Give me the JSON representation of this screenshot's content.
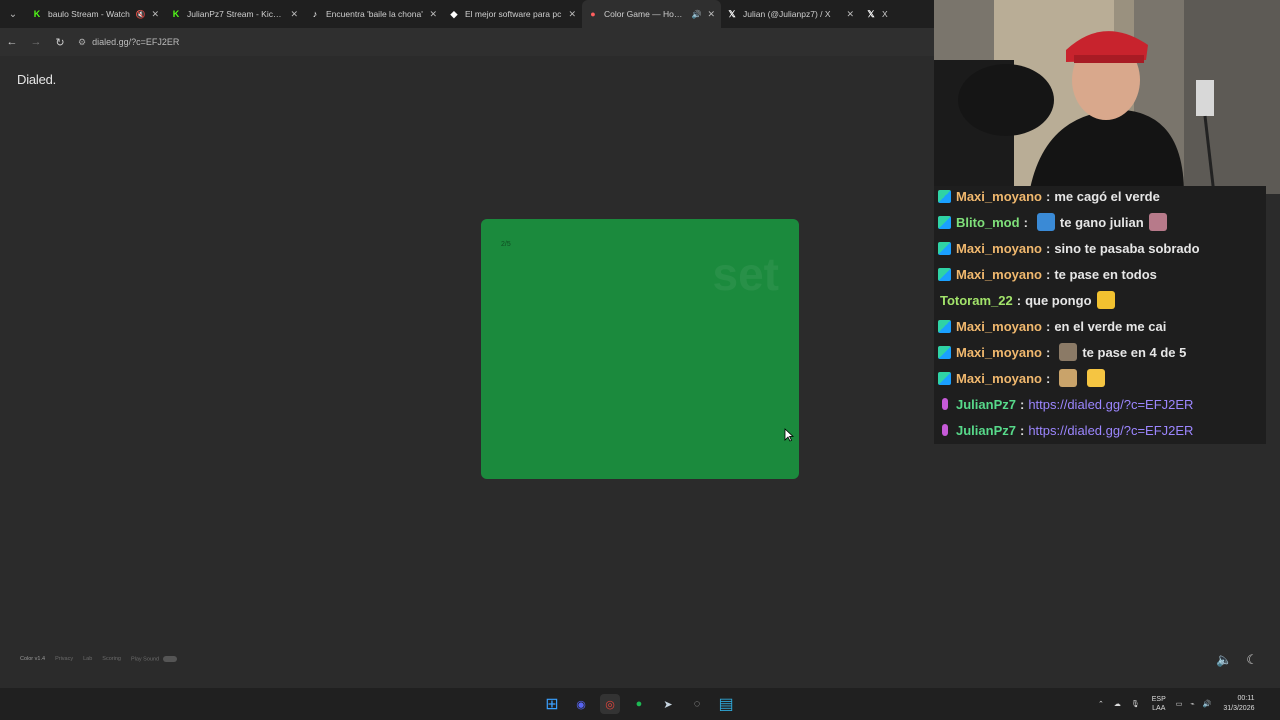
{
  "browser": {
    "tabs": [
      {
        "title": "baulo Stream - Watch",
        "icon": "kick-icon",
        "color": "#53fc18",
        "extra": "🔇",
        "active": false
      },
      {
        "title": "JulianPz7 Stream - Kick D",
        "icon": "kick-icon",
        "color": "#53fc18",
        "extra": "",
        "active": false
      },
      {
        "title": "Encuentra 'baile la chona'",
        "icon": "tiktok-icon",
        "color": "#ffffff",
        "extra": "",
        "active": false
      },
      {
        "title": "El mejor software para pc",
        "icon": "app-icon",
        "color": "#ffffff",
        "extra": "",
        "active": false
      },
      {
        "title": "Color Game — How W",
        "icon": "color-wheel-icon",
        "color": "#ff5e5e",
        "extra": "🔊",
        "active": true
      },
      {
        "title": "Julian (@Julianpz7) / X",
        "icon": "x-icon",
        "color": "#ffffff",
        "extra": "",
        "active": false
      },
      {
        "title": "X",
        "icon": "x-icon",
        "color": "#ffffff",
        "extra": "",
        "active": false
      }
    ],
    "url": "dialed.gg/?c=EFJ2ER"
  },
  "page": {
    "logo": "Dialed.",
    "card": {
      "counter": "2/5",
      "watermark": "set",
      "color": "#1b8a3d"
    },
    "footer": {
      "version": "Color v1.4",
      "links": [
        "Privacy",
        "Lab",
        "Scoring",
        "Play Sound"
      ]
    },
    "icons": [
      "volume-icon",
      "moon-icon"
    ]
  },
  "chat": {
    "messages": [
      {
        "badge": "mod",
        "user": "Maxi_moyano",
        "color": "#f0b86e",
        "text": "me cagó el verde"
      },
      {
        "badge": "mod",
        "user": "Blito_mod",
        "color": "#7fe07a",
        "text": "te gano julian",
        "emote_before": "#3a8ad6",
        "emote_after": "#b77a8a"
      },
      {
        "badge": "mod",
        "user": "Maxi_moyano",
        "color": "#f0b86e",
        "text": "sino te pasaba sobrado"
      },
      {
        "badge": "mod",
        "user": "Maxi_moyano",
        "color": "#f0b86e",
        "text": "te pase en todos"
      },
      {
        "badge": "none",
        "user": "Totoram_22",
        "color": "#a2e36a",
        "text": "que pongo",
        "emote_after": "#f2c230"
      },
      {
        "badge": "mod",
        "user": "Maxi_moyano",
        "color": "#f0b86e",
        "text": "en el verde me cai"
      },
      {
        "badge": "mod",
        "user": "Maxi_moyano",
        "color": "#f0b86e",
        "text": "te pase en 4 de 5",
        "emote_before": "#8b7a66"
      },
      {
        "badge": "mod",
        "user": "Maxi_moyano",
        "color": "#f0b86e",
        "text": "",
        "emote_before": "#c9a36a",
        "emote_after": "#f5c542"
      },
      {
        "badge": "mic",
        "user": "JulianPz7",
        "color": "#57d98a",
        "link": "https://dialed.gg/?c=EFJ2ER"
      },
      {
        "badge": "mic",
        "user": "JulianPz7",
        "color": "#57d98a",
        "link": "https://dialed.gg/?c=EFJ2ER"
      }
    ]
  },
  "taskbar": {
    "apps": [
      {
        "name": "windows-start-icon",
        "color": "#3aa0ff"
      },
      {
        "name": "discord-icon",
        "color": "#5865f2"
      },
      {
        "name": "chrome-icon",
        "color": "#e8453c"
      },
      {
        "name": "spotify-icon",
        "color": "#1db954"
      },
      {
        "name": "steam-icon",
        "color": "#c7d5e0"
      },
      {
        "name": "obs-icon",
        "color": "#bbbbbb"
      },
      {
        "name": "file-explorer-icon",
        "color": "#2fa7d8"
      }
    ],
    "language": "ESP",
    "language_sub": "LAA",
    "time": "00:11",
    "date": "31/3/2026"
  }
}
